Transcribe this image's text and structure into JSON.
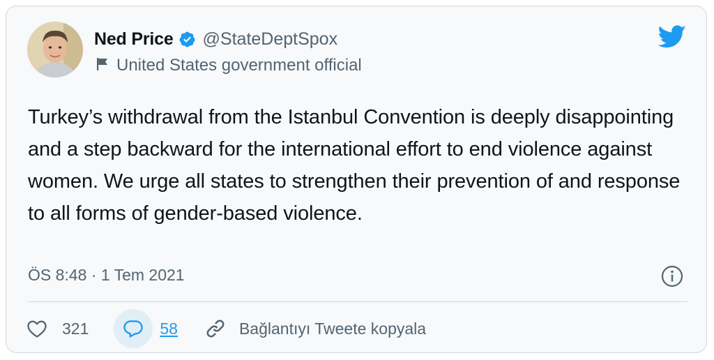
{
  "author": {
    "display_name": "Ned Price",
    "handle": "@StateDeptSpox",
    "verified": true,
    "label": "United States government official"
  },
  "tweet": {
    "text": "Turkey’s withdrawal from the Istanbul Convention is deeply disappointing and a step backward for the international effort to end violence against women. We urge all states to strengthen their prevention of and response to all forms of gender-based violence.",
    "timestamp": "ÖS 8:48 · 1 Tem 2021"
  },
  "actions": {
    "likes": "321",
    "replies": "58",
    "copy_link": "Bağlantıyı Tweete kopyala"
  },
  "icons": {
    "brand": "twitter-bird-icon",
    "verified": "verified-badge-icon",
    "label": "flag-icon",
    "info": "info-icon",
    "like": "heart-icon",
    "reply": "reply-bubble-icon",
    "link": "link-icon"
  },
  "colors": {
    "brand_blue": "#1d9bf0",
    "text": "#0f1419",
    "muted": "#536471",
    "background": "#f7f9fa"
  }
}
